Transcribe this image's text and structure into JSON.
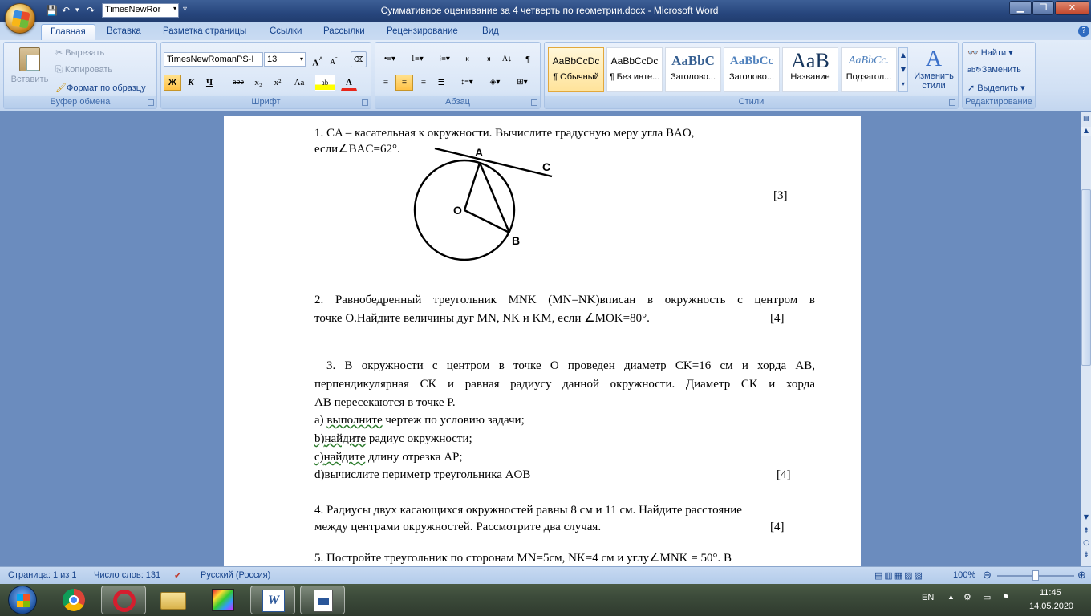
{
  "window": {
    "title": "Суммативное оценивание за 4 четверть по геометрии.docx - Microsoft Word",
    "qat_font": "TimesNewRor"
  },
  "tabs": [
    "Главная",
    "Вставка",
    "Разметка страницы",
    "Ссылки",
    "Рассылки",
    "Рецензирование",
    "Вид"
  ],
  "ribbon": {
    "clipboard": {
      "paste": "Вставить",
      "cut": "Вырезать",
      "copy": "Копировать",
      "format_painter": "Формат по образцу",
      "label": "Буфер обмена"
    },
    "font": {
      "name": "TimesNewRomanPS-I",
      "size": "13",
      "bold": "Ж",
      "italic": "К",
      "underline": "Ч",
      "strike": "abe",
      "sub": "x₂",
      "sup": "x²",
      "case": "Aa",
      "label": "Шрифт"
    },
    "paragraph": {
      "label": "Абзац"
    },
    "styles": {
      "tiles": [
        {
          "sample": "AaBbCcDc",
          "name": "¶ Обычный"
        },
        {
          "sample": "AaBbCcDc",
          "name": "¶ Без инте..."
        },
        {
          "sample": "AaBbC",
          "name": "Заголово..."
        },
        {
          "sample": "AaBbCc",
          "name": "Заголово..."
        },
        {
          "sample": "AaB",
          "name": "Название"
        },
        {
          "sample": "AaBbCc.",
          "name": "Подзагол..."
        }
      ],
      "change": "Изменить стили",
      "label": "Стили"
    },
    "editing": {
      "find": "Найти",
      "replace": "Заменить",
      "select": "Выделить",
      "label": "Редактирование"
    }
  },
  "document": {
    "q1_line1": "1. CA – касательная к окружности. Вычислите градусную меру угла BAO,",
    "q1_line2": "если∠BAC=62°.",
    "q1_score": "[3]",
    "figure": {
      "A": "A",
      "B": "B",
      "C": "C",
      "O": "O"
    },
    "q2_line1": "2. Равнобедренный треугольник MNK (MN=NK)вписан в окружность с центром в",
    "q2_line2": "точке O.Найдите величины дуг MN, NK и KM, если ∠MOK=80°.",
    "q2_score": "[4]",
    "q3_line1": "3. В окружности с центром в точке O проведен диаметр CK=16 см и хорда AB,",
    "q3_line2": "перпендикулярная CK и равная радиусу данной окружности. Диаметр CK и хорда",
    "q3_line3": "AB пересекаются в точке P.",
    "q3_a_pre": "а) ",
    "q3_a_word": "выполните",
    "q3_a_post": " чертеж по условию задачи;",
    "q3_b_pre": "b)",
    "q3_b_word": "найдите",
    "q3_b_post": " радиус окружности;",
    "q3_c_pre": "c)",
    "q3_c_word": "найдите",
    "q3_c_post": " длину отрезка AP;",
    "q3_d": "d)вычислите периметр треугольника AOB",
    "q3_score": "[4]",
    "q4_line1": "4. Радиусы двух касающихся окружностей равны 8 см и 11 см. Найдите расстояние",
    "q4_line2": "между центрами окружностей. Рассмотрите два случая.",
    "q4_score": "[4]",
    "q5_line1": "5. Постройте треугольник по сторонам MN=5см, NK=4 см и углу∠MNK = 50°. В"
  },
  "status": {
    "page": "Страница: 1 из 1",
    "words": "Число слов: 131",
    "language": "Русский (Россия)",
    "zoom": "100%",
    "zoom_value": 100
  },
  "taskbar": {
    "lang": "EN",
    "time": "11:45",
    "date": "14.05.2020"
  },
  "colors": {
    "accent": "#15428b",
    "doc_bg": "#6b8cbe"
  }
}
